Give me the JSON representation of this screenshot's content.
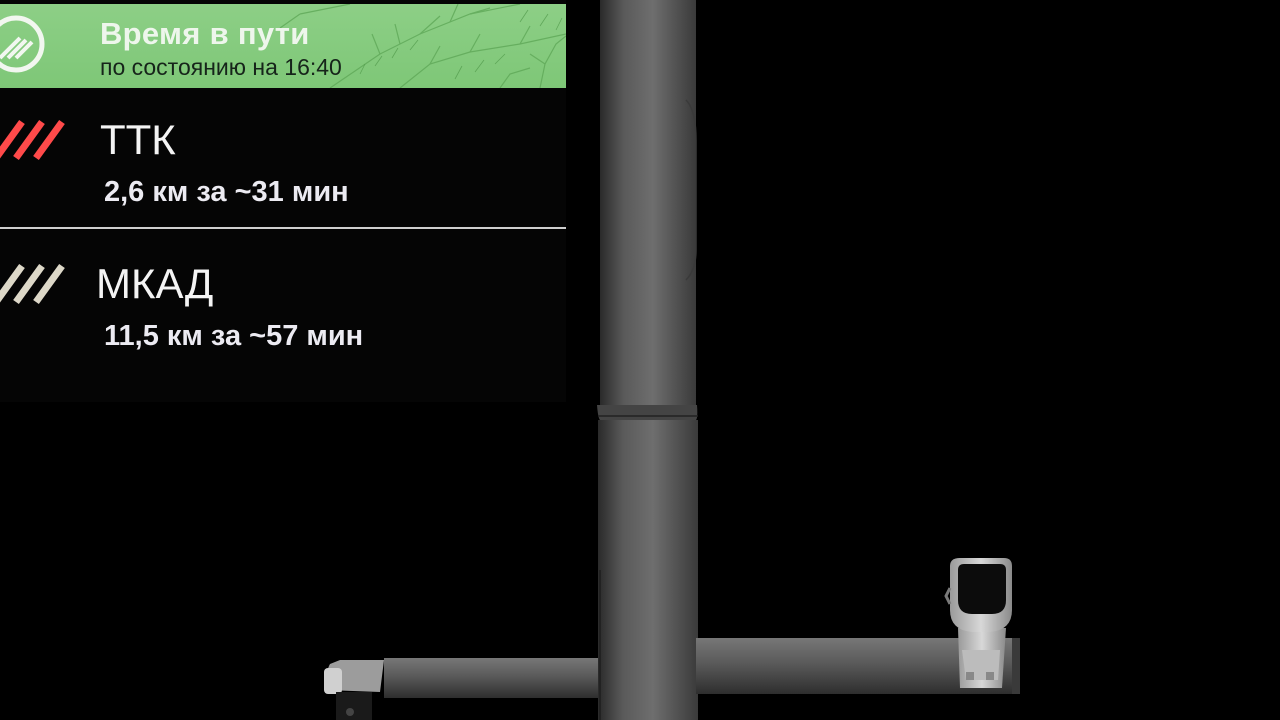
{
  "sign": {
    "header": {
      "title": "Время в пути",
      "subtitle": "по состоянию на 16:40",
      "background_color": "#7ec777",
      "icon": "speedometer-clock-icon"
    },
    "routes": [
      {
        "name": "ТТК",
        "info": "2,6 км за ~31 мин",
        "status_color": "#ff4a4a",
        "icon": "congestion-stripes-icon"
      },
      {
        "name": "МКАД",
        "info": "11,5 км за ~57 мин",
        "status_color": "#ddd8c8",
        "icon": "congestion-stripes-icon"
      }
    ]
  }
}
